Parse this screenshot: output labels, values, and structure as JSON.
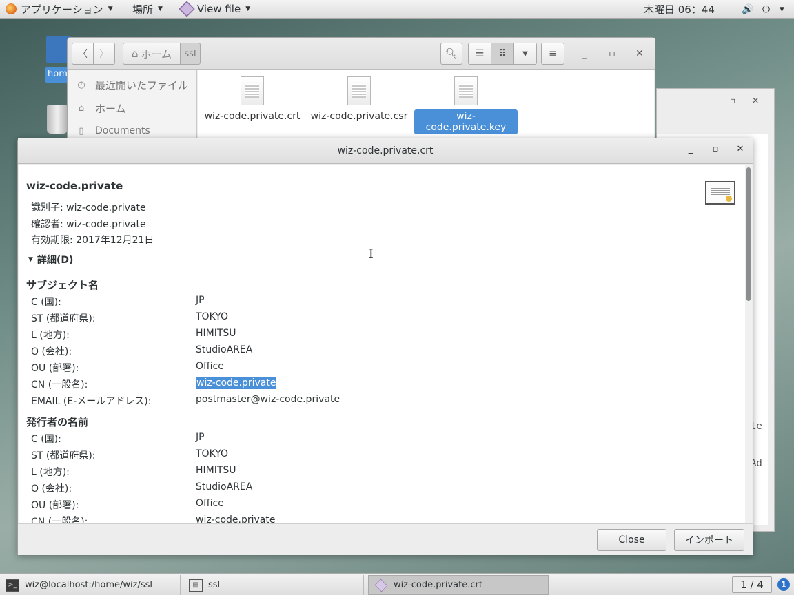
{
  "topbar": {
    "apps_label": "アプリケーション",
    "places_label": "場所",
    "app_menu_label": "View file",
    "clock": "木曜日 06：44"
  },
  "desktop": {
    "home_label": "home"
  },
  "file_manager": {
    "breadcrumb_home": "ホーム",
    "breadcrumb_current": "ssl",
    "sidebar": [
      {
        "icon": "clock-icon",
        "label": "最近開いたファイル"
      },
      {
        "icon": "home-icon",
        "label": "ホーム"
      },
      {
        "icon": "document-icon",
        "label": "Documents"
      }
    ],
    "files": [
      {
        "name": "wiz-code.private.crt",
        "selected": false
      },
      {
        "name": "wiz-code.private.csr",
        "selected": false
      },
      {
        "name": "wiz-code.private.key",
        "selected": true
      }
    ]
  },
  "dialog": {
    "title": "wiz-code.private.crt",
    "cert_name": "wiz-code.private",
    "identifier": "識別子:  wiz-code.private",
    "verifier": "確認者:  wiz-code.private",
    "expiry": "有効期限: 2017年12月21日",
    "details_label": "詳細(D)",
    "subject_heading": "サブジェクト名",
    "subject": [
      {
        "label": "C (国):",
        "value": "JP"
      },
      {
        "label": "ST (都道府県):",
        "value": "TOKYO"
      },
      {
        "label": "L (地方):",
        "value": "HIMITSU"
      },
      {
        "label": "O (会社):",
        "value": "StudioAREA"
      },
      {
        "label": "OU (部署):",
        "value": "Office"
      },
      {
        "label": "CN (一般名):",
        "value": "wiz-code.private"
      },
      {
        "label": "EMAIL (E-メールアドレス):",
        "value": "postmaster@wiz-code.private"
      }
    ],
    "issuer_heading": "発行者の名前",
    "issuer": [
      {
        "label": "C (国):",
        "value": "JP"
      },
      {
        "label": "ST (都道府県):",
        "value": "TOKYO"
      },
      {
        "label": "L (地方):",
        "value": "HIMITSU"
      },
      {
        "label": "O (会社):",
        "value": "StudioAREA"
      },
      {
        "label": "OU (部署):",
        "value": "Office"
      },
      {
        "label": "CN (一般名):",
        "value": "wiz-code.private"
      }
    ],
    "close_label": "Close",
    "import_label": "インポート"
  },
  "background_window": {
    "text_fragment_1": "te",
    "text_fragment_2": "Ad"
  },
  "taskbar": {
    "tasks": [
      {
        "label": "wiz@localhost:/home/wiz/ssl",
        "active": false
      },
      {
        "label": "ssl",
        "active": false
      },
      {
        "label": "wiz-code.private.crt",
        "active": true
      }
    ],
    "workspace": "1 / 4",
    "notification_count": "1"
  }
}
